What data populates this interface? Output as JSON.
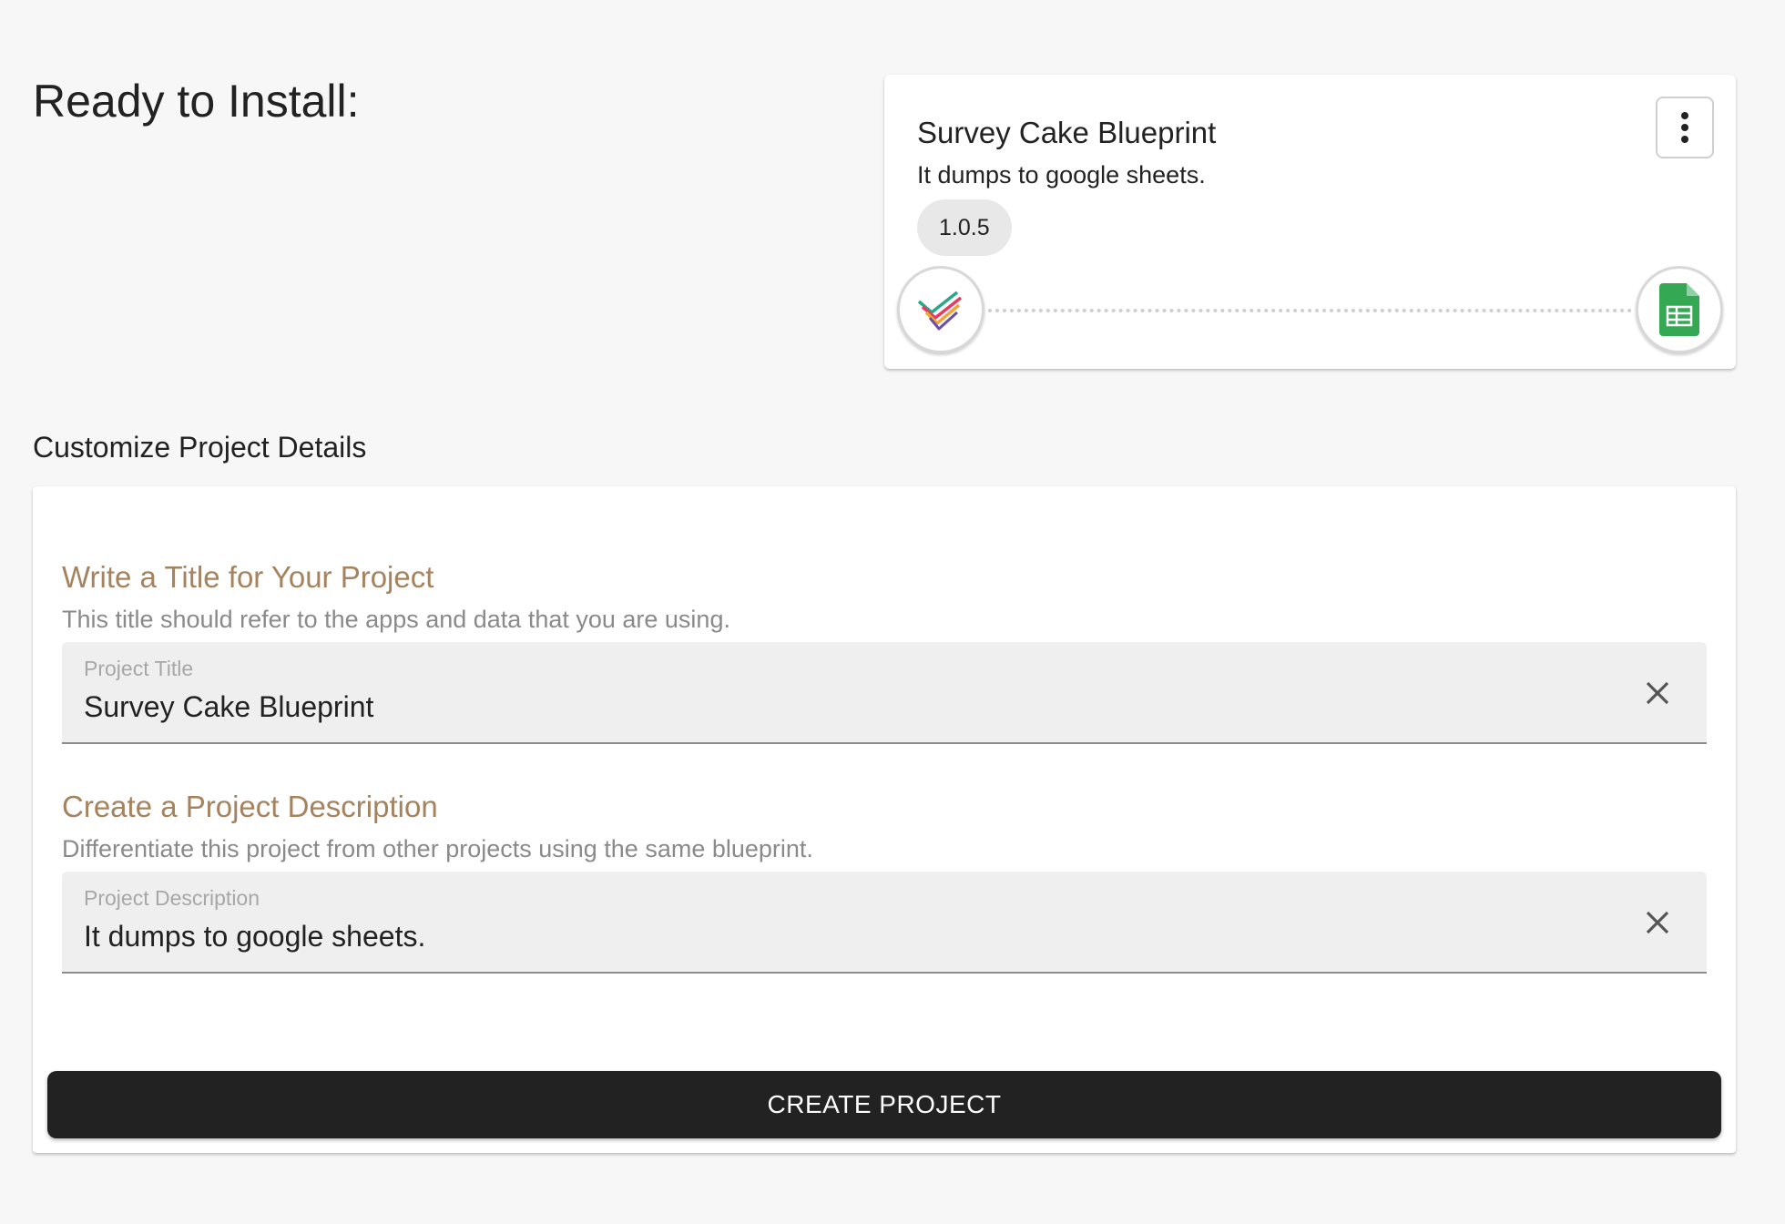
{
  "header": {
    "title": "Ready to Install:"
  },
  "blueprint": {
    "title": "Survey Cake Blueprint",
    "description": "It dumps to google sheets.",
    "version": "1.0.5",
    "source_app_icon": "surveycake-checkmark-icon",
    "target_app_icon": "google-sheets-icon",
    "menu_icon": "more-vertical-icon"
  },
  "customize": {
    "section_title": "Customize Project Details",
    "title_field": {
      "heading": "Write a Title for Your Project",
      "help": "This title should refer to the apps and data that you are using.",
      "label": "Project Title",
      "value": "Survey Cake Blueprint"
    },
    "description_field": {
      "heading": "Create a Project Description",
      "help": "Differentiate this project from other projects using the same blueprint.",
      "label": "Project Description",
      "value": "It dumps to google sheets."
    },
    "create_button": "CREATE PROJECT"
  },
  "colors": {
    "accent_heading": "#a5835f",
    "button_bg": "#222222",
    "sheets_green": "#34a853"
  }
}
